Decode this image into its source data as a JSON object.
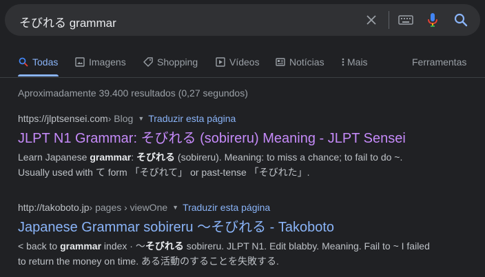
{
  "search": {
    "query": "そびれる grammar"
  },
  "tabs": [
    {
      "label": "Todas",
      "icon": "search-icon",
      "active": true
    },
    {
      "label": "Imagens",
      "icon": "image-icon"
    },
    {
      "label": "Shopping",
      "icon": "tag-icon"
    },
    {
      "label": "Vídeos",
      "icon": "play-icon"
    },
    {
      "label": "Notícias",
      "icon": "news-icon"
    },
    {
      "label": "Mais",
      "icon": "more-vert-icon"
    }
  ],
  "tools_label": "Ferramentas",
  "stats": "Aproximadamente 39.400 resultados (0,27 segundos)",
  "results": [
    {
      "site": "https://jlptsensei.com",
      "path": " › Blog",
      "translate": "Traduzir esta página",
      "title": "JLPT N1 Grammar: そびれる (sobireru) Meaning - JLPT Sensei",
      "line1": {
        "a": "Learn Japanese ",
        "b1": "grammar",
        "c": ": ",
        "b2": "そびれる",
        "d": " (sobireru). Meaning: to miss a chance; to fail to do ~."
      },
      "line2": "Usually used with て form 「そびれて」 or past-tense 「そびれた」."
    },
    {
      "site": "http://takoboto.jp",
      "path": " › pages › viewOne",
      "translate": "Traduzir esta página",
      "title": "Japanese Grammar sobireru 〜そびれる - Takoboto",
      "line1": {
        "a": "< back to ",
        "b1": "grammar",
        "c": " index · 〜",
        "b2": "そびれる",
        "d": " sobireru. JLPT N1. Edit blabby. Meaning. Fail to ~ I failed"
      },
      "line2": "to return the money on time. ある活動のすることを失敗する."
    }
  ],
  "colors": {
    "background": "#202124",
    "link": "#8ab4f8",
    "visited": "#c58af9",
    "mic_blue": "#4285f4",
    "mic_red": "#ea4335"
  }
}
